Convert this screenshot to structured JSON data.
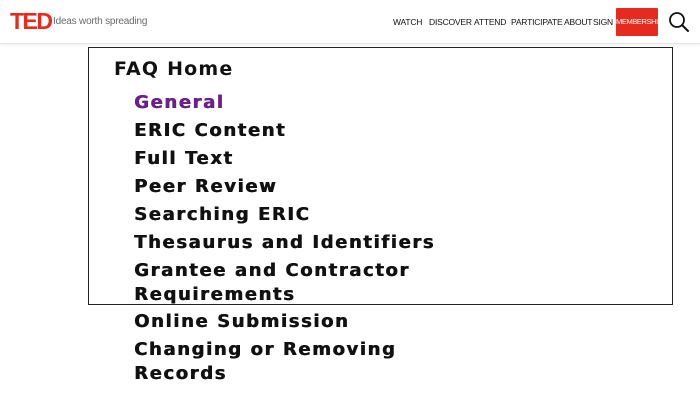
{
  "header": {
    "logo": "TED",
    "tagline": "Ideas worth spreading",
    "nav": {
      "watch": "WATCH",
      "discover": "DISCOVER",
      "attend": "ATTEND",
      "participate": "PARTICIPATE",
      "about": "ABOUT",
      "sign_in": "SIGN IN"
    },
    "membership_label": "MEMBERSHIP",
    "accent_color": "#e62b1e",
    "search_icon": "search-icon"
  },
  "faq": {
    "heading": "FAQ Home",
    "active_color": "#6a1f8a",
    "items": [
      {
        "label": "General",
        "active": true
      },
      {
        "label": "ERIC Content"
      },
      {
        "label": "Full Text"
      },
      {
        "label": "Peer Review"
      },
      {
        "label": "Searching ERIC"
      },
      {
        "label": "Thesaurus and Identifiers"
      },
      {
        "line1": "Grantee and Contractor",
        "line2": "Requirements"
      },
      {
        "label": "Online Submission"
      },
      {
        "line1": "Changing or Removing",
        "line2": "Records"
      }
    ]
  }
}
